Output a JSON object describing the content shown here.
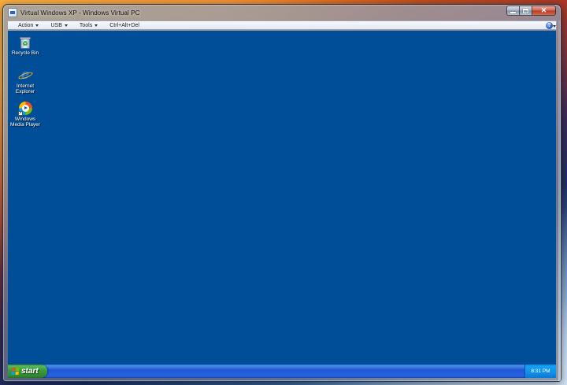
{
  "window": {
    "title": "Virtual Windows XP - Windows Virtual PC"
  },
  "menu": {
    "items": [
      {
        "label": "Action",
        "has_arrow": true
      },
      {
        "label": "USB",
        "has_arrow": true
      },
      {
        "label": "Tools",
        "has_arrow": true
      },
      {
        "label": "Ctrl+Alt+Del",
        "has_arrow": false
      }
    ],
    "help_glyph": "?"
  },
  "desktop": {
    "background_color": "#004e98",
    "icons": [
      {
        "label": "Recycle Bin",
        "icon": "recycle-bin-icon"
      },
      {
        "label": "Internet Explorer",
        "icon": "internet-explorer-icon"
      },
      {
        "label": "Windows Media Player",
        "icon": "windows-media-player-icon"
      }
    ]
  },
  "taskbar": {
    "start_label": "start",
    "clock": "8:31 PM"
  }
}
